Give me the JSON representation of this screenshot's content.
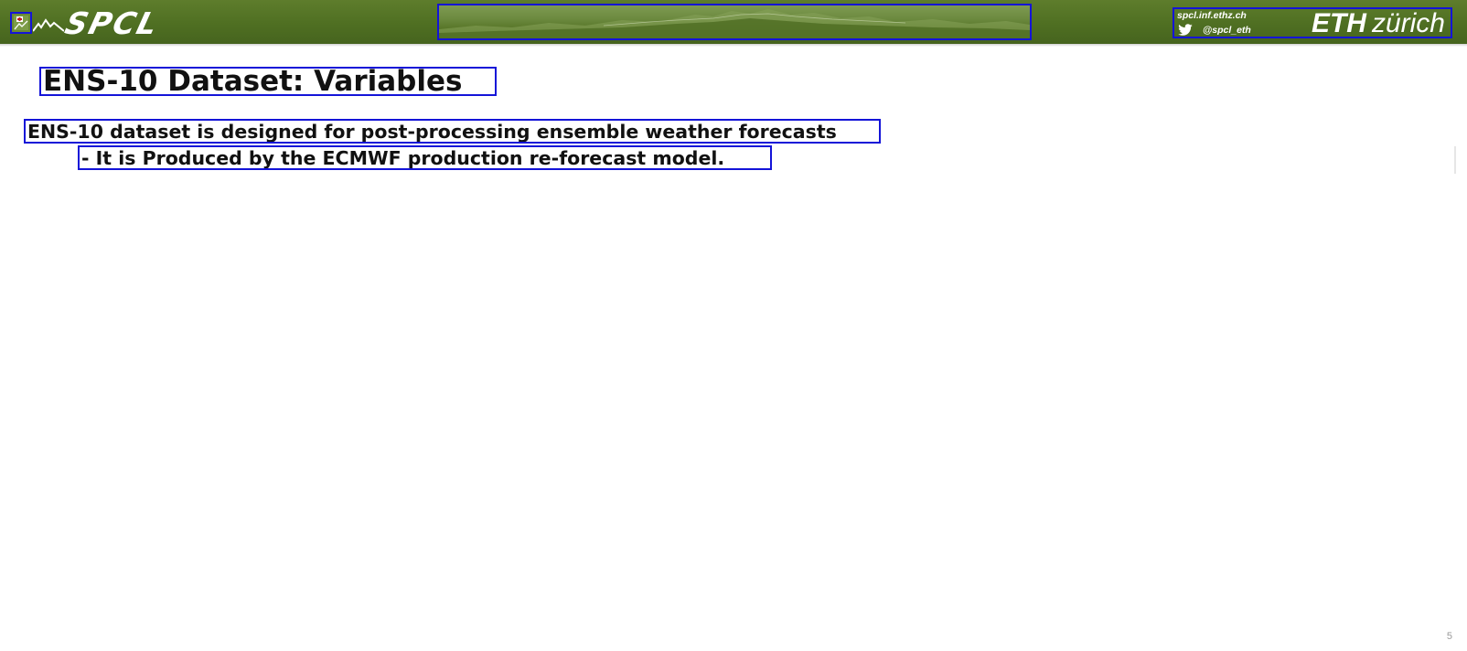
{
  "header": {
    "logo_text": "SPCL",
    "banner_icon": "mountain-panorama",
    "eth": {
      "site": "spcl.inf.ethz.ch",
      "handle": "@spcl_eth",
      "logo_bold": "ETH",
      "logo_light": "zürich"
    },
    "colors": {
      "header_green": "#4f6f22",
      "annotation_blue": "#1414d8"
    }
  },
  "slide": {
    "title": "ENS-10 Dataset: Variables",
    "lines": [
      "ENS-10 dataset is designed for post-processing ensemble weather forecasts",
      "- It is Produced by the ECMWF production re-forecast model."
    ],
    "page_number": "5"
  }
}
